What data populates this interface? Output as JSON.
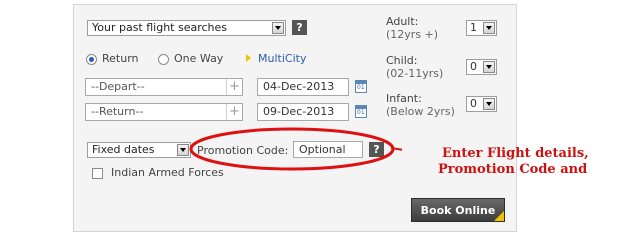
{
  "past_searches": {
    "label": "Your past flight searches",
    "help": "?"
  },
  "trip_type": {
    "options": [
      {
        "label": "Return",
        "selected": true
      },
      {
        "label": "One Way",
        "selected": false
      }
    ],
    "multicity_label": "MultiCity"
  },
  "depart": {
    "placeholder": "--Depart--",
    "date": "04-Dec-2013"
  },
  "return": {
    "placeholder": "--Return--",
    "date": "09-Dec-2013"
  },
  "calendar_icon_text": "01",
  "passengers": {
    "adult": {
      "label": "Adult:",
      "range": "(12yrs +)",
      "value": "1"
    },
    "child": {
      "label": "Child:",
      "range": "(02-11yrs)",
      "value": "0"
    },
    "infant": {
      "label": "Infant:",
      "range": "(Below 2yrs)",
      "value": "0"
    }
  },
  "dates_mode": {
    "value": "Fixed dates"
  },
  "promotion": {
    "label": "Promotion Code:",
    "placeholder": "Optional",
    "help": "?"
  },
  "armed_forces": {
    "label": "Indian Armed Forces",
    "checked": false
  },
  "book_online": {
    "label": "Book Online"
  },
  "annotation": {
    "line1": "Enter Flight details,",
    "line2": "Promotion Code and",
    "color": "#cc1111"
  },
  "colors": {
    "book_accent": "#f3c200",
    "multicity_accent": "#f3c200"
  }
}
